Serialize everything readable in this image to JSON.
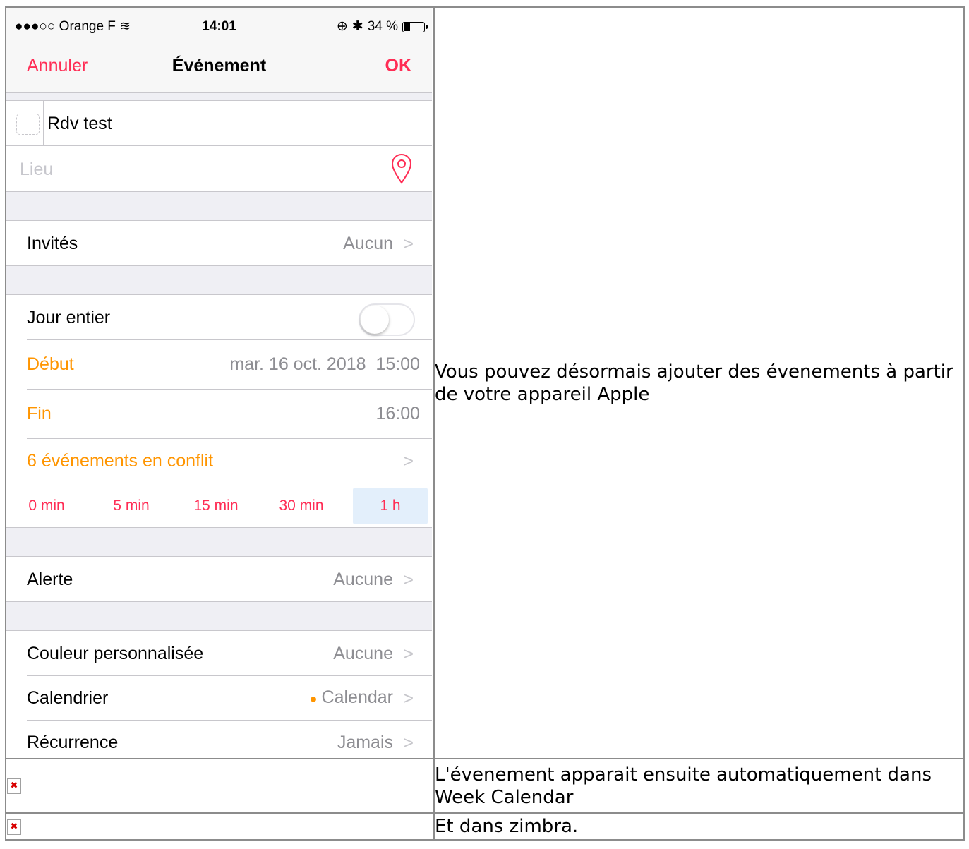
{
  "phone": {
    "status_bar": {
      "carrier": "●●●○○ Orange F",
      "time": "14:01",
      "battery": "34 %",
      "battery_level": 0.34
    },
    "nav": {
      "cancel": "Annuler",
      "title": "Événement",
      "ok": "OK"
    },
    "event_title": "Rdv test",
    "location_placeholder": "Lieu",
    "invitees": {
      "label": "Invités",
      "value": "Aucun"
    },
    "all_day": {
      "label": "Jour entier",
      "on": false
    },
    "start": {
      "label": "Début",
      "value": "mar. 16 oct. 2018  15:00"
    },
    "end": {
      "label": "Fin",
      "value": "16:00"
    },
    "conflicts": {
      "label": "6 événements en conflit"
    },
    "durations": [
      "0 min",
      "5 min",
      "15 min",
      "30 min",
      "1 h"
    ],
    "selected_duration": "1 h",
    "alert": {
      "label": "Alerte",
      "value": "Aucune"
    },
    "custom_color": {
      "label": "Couleur personnalisée",
      "value": "Aucune"
    },
    "calendar": {
      "label": "Calendrier",
      "value": "Calendar",
      "dot_color": "#ff9500"
    },
    "recurrence": {
      "label": "Récurrence",
      "value": "Jamais"
    }
  },
  "rows": [
    {
      "text": "Vous pouvez désormais ajouter des évenements à partir de votre appareil Apple"
    },
    {
      "text": "L'évenement apparait ensuite automatiquement dans Week Calendar"
    },
    {
      "text": "Et dans zimbra."
    }
  ],
  "colors": {
    "accent_red": "#ff2d55",
    "accent_orange": "#ff9500",
    "secondary_text": "#8e8e93",
    "selected_slot": "#e3effb"
  }
}
